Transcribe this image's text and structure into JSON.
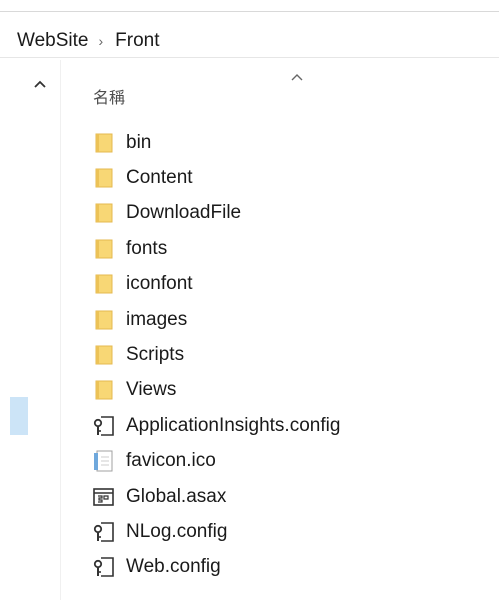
{
  "breadcrumb": {
    "items": [
      "WebSite",
      "Front"
    ],
    "separator": "›"
  },
  "list": {
    "name_header": "名稱",
    "items": [
      {
        "name": "bin",
        "icon": "folder-icon"
      },
      {
        "name": "Content",
        "icon": "folder-icon"
      },
      {
        "name": "DownloadFile",
        "icon": "folder-icon"
      },
      {
        "name": "fonts",
        "icon": "folder-icon"
      },
      {
        "name": "iconfont",
        "icon": "folder-icon"
      },
      {
        "name": "images",
        "icon": "folder-icon"
      },
      {
        "name": "Scripts",
        "icon": "folder-icon"
      },
      {
        "name": "Views",
        "icon": "folder-icon"
      },
      {
        "name": "ApplicationInsights.config",
        "icon": "config-file-icon"
      },
      {
        "name": "favicon.ico",
        "icon": "image-file-icon"
      },
      {
        "name": "Global.asax",
        "icon": "asax-file-icon"
      },
      {
        "name": "NLog.config",
        "icon": "config-file-icon"
      },
      {
        "name": "Web.config",
        "icon": "config-file-icon"
      }
    ]
  },
  "colors": {
    "folder": "#f8d775",
    "folder_dark": "#e8b84a",
    "selection": "#cce4f7",
    "text": "#1a1a1a"
  }
}
